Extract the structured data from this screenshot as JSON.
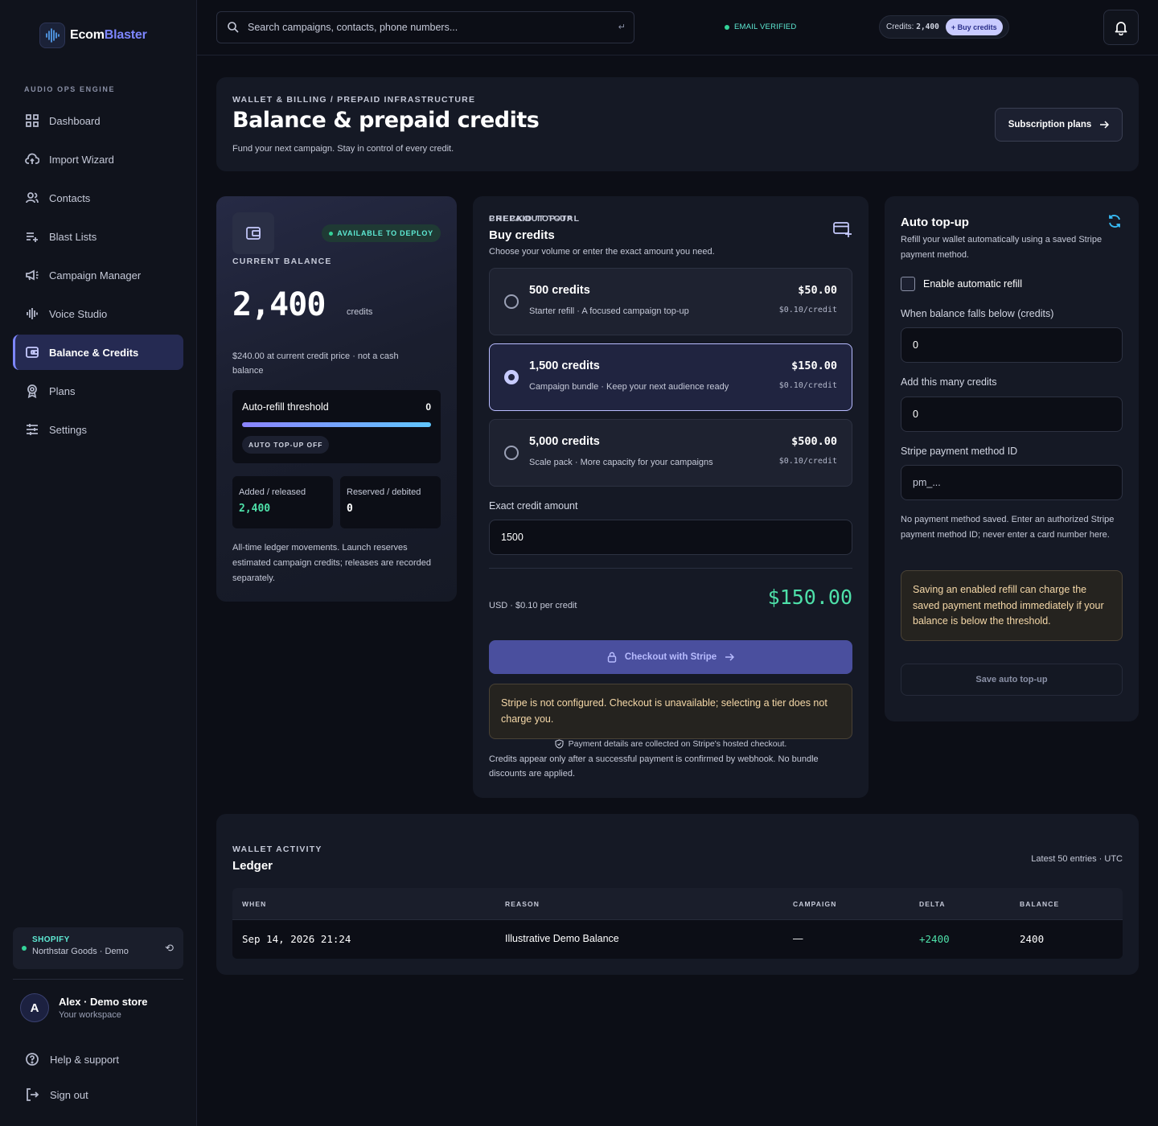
{
  "app": {
    "brand_part1": "Ecom",
    "brand_part2": "Blaster",
    "section_label": "AUDIO OPS ENGINE"
  },
  "sidebar": {
    "items": [
      {
        "label": "Dashboard",
        "icon": "grid-icon"
      },
      {
        "label": "Import Wizard",
        "icon": "cloud-upload-icon"
      },
      {
        "label": "Contacts",
        "icon": "users-icon"
      },
      {
        "label": "Blast Lists",
        "icon": "list-add-icon"
      },
      {
        "label": "Campaign Manager",
        "icon": "megaphone-icon"
      },
      {
        "label": "Voice Studio",
        "icon": "waveform-icon"
      },
      {
        "label": "Balance & Credits",
        "icon": "wallet-icon",
        "active": true
      },
      {
        "label": "Plans",
        "icon": "badge-icon"
      },
      {
        "label": "Settings",
        "icon": "sliders-icon"
      }
    ],
    "store": {
      "platform": "SHOPIFY",
      "name": "Northstar Goods · Demo"
    },
    "user": {
      "initial": "A",
      "name": "Alex · Demo store",
      "workspace": "Your workspace"
    },
    "help_label": "Help & support",
    "signout_label": "Sign out"
  },
  "topbar": {
    "search_placeholder": "Search campaigns, contacts, phone numbers...",
    "search_hint": "↵",
    "email_status": "EMAIL VERIFIED",
    "credits_label": "Credits:",
    "credits_value": "2,400",
    "buy_credits_label": "+ Buy credits"
  },
  "header": {
    "kicker": "WALLET & BILLING / PREPAID INFRASTRUCTURE",
    "title": "Balance & prepaid credits",
    "subtitle": "Fund your next campaign. Stay in control of every credit.",
    "subscription_button": "Subscription plans"
  },
  "balance": {
    "status_badge": "AVAILABLE TO DEPLOY",
    "kicker": "CURRENT BALANCE",
    "amount": "2,400",
    "unit": "credits",
    "note": "$240.00 at current credit price · not a cash balance",
    "threshold_label": "Auto-refill threshold",
    "threshold_value": "0",
    "threshold_fill": 1.0,
    "autotopup_status": "AUTO TOP-UP OFF",
    "added_label": "Added / released",
    "added_value": "2,400",
    "reserved_label": "Reserved / debited",
    "reserved_value": "0",
    "footnote": "All-time ledger movements. Launch reserves estimated campaign credits; releases are recorded separately.",
    "colors": {
      "added": "#4ee0a9",
      "reserved": "#ffffff"
    }
  },
  "buy": {
    "kicker": "PREPAID TOP-UP",
    "title": "Buy credits",
    "subtitle": "Choose your volume or enter the exact amount you need.",
    "tiers": [
      {
        "name": "500 credits",
        "desc": "Starter refill · A focused campaign top-up",
        "price": "$50.00",
        "per": "$0.10/credit",
        "selected": false
      },
      {
        "name": "1,500 credits",
        "desc": "Campaign bundle · Keep your next audience ready",
        "price": "$150.00",
        "per": "$0.10/credit",
        "selected": true
      },
      {
        "name": "5,000 credits",
        "desc": "Scale pack · More capacity for your campaigns",
        "price": "$500.00",
        "per": "$0.10/credit",
        "selected": false
      }
    ],
    "exact_label": "Exact credit amount",
    "exact_value": "1500",
    "total_kicker": "CHECKOUT TOTAL",
    "total_sub": "USD · $0.10 per credit",
    "total_value": "$150.00",
    "checkout_button": "Checkout with Stripe",
    "warning": "Stripe is not configured. Checkout is unavailable; selecting a tier does not charge you.",
    "secure_note": "Payment details are collected on Stripe's hosted checkout.",
    "footnote": "Credits appear only after a successful payment is confirmed by webhook. No bundle discounts are applied."
  },
  "auto": {
    "title": "Auto top-up",
    "subtitle": "Refill your wallet automatically using a saved Stripe payment method.",
    "enable_label": "Enable automatic refill",
    "threshold_label": "When balance falls below (credits)",
    "threshold_value": "0",
    "amount_label": "Add this many credits",
    "amount_value": "0",
    "pm_label": "Stripe payment method ID",
    "pm_placeholder": "pm_...",
    "note": "No payment method saved. Enter an authorized Stripe payment method ID; never enter a card number here.",
    "warning": "Saving an enabled refill can charge the saved payment method immediately if your balance is below the threshold.",
    "save_button": "Save auto top-up"
  },
  "ledger": {
    "kicker": "WALLET ACTIVITY",
    "title": "Ledger",
    "meta": "Latest 50 entries · UTC",
    "columns": [
      "WHEN",
      "REASON",
      "CAMPAIGN",
      "DELTA",
      "BALANCE"
    ],
    "rows": [
      {
        "when": "Sep 14, 2026 21:24",
        "reason": "Illustrative Demo Balance",
        "campaign": "—",
        "delta": "+2400",
        "balance": "2400"
      }
    ]
  }
}
